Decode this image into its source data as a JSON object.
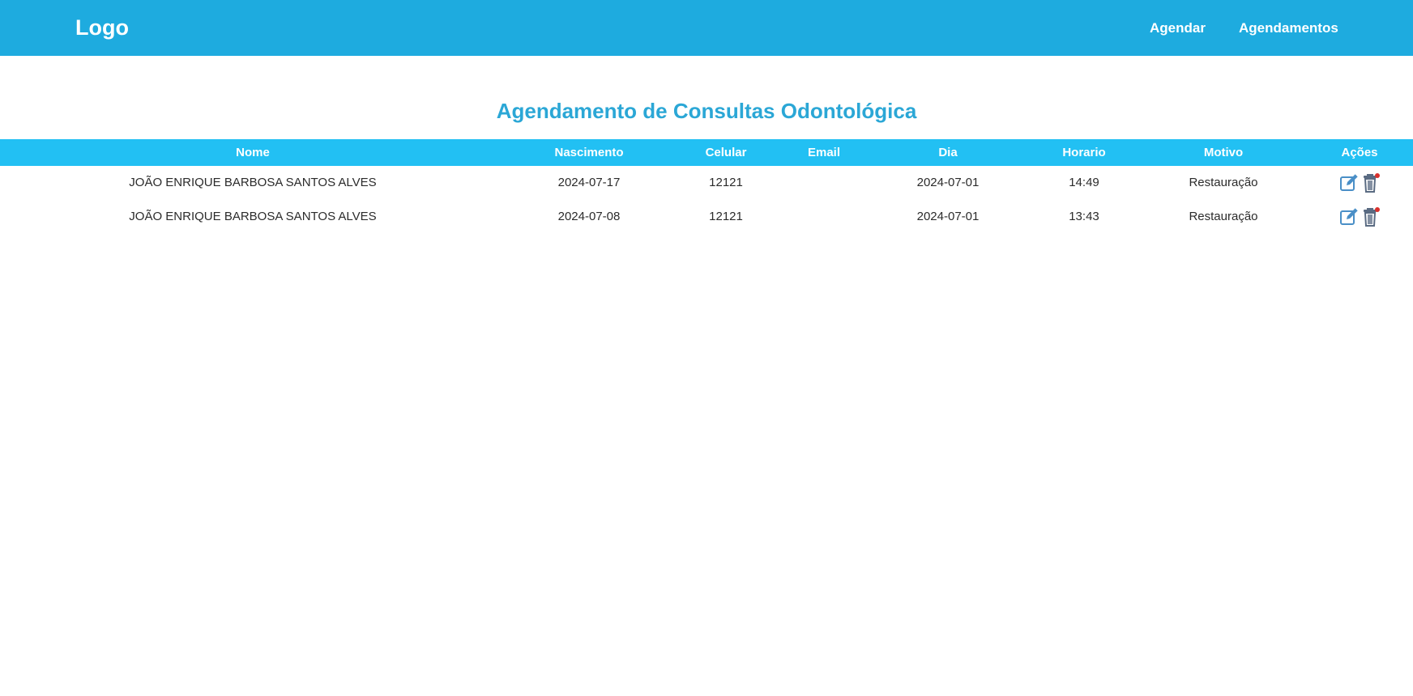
{
  "navbar": {
    "logo": "Logo",
    "links": [
      "Agendar",
      "Agendamentos"
    ],
    "background": "#1eabdf"
  },
  "page": {
    "title": "Agendamento de Consultas Odontológica",
    "title_color": "#2ba7d6"
  },
  "table": {
    "header_background": "#22c0f3",
    "columns": [
      "Nome",
      "Nascimento",
      "Celular",
      "Email",
      "Dia",
      "Horario",
      "Motivo",
      "Ações"
    ],
    "rows": [
      {
        "nome": "JOÃO ENRIQUE BARBOSA SANTOS ALVES",
        "nascimento": "2024-07-17",
        "celular": "12121",
        "email": "",
        "dia": "2024-07-01",
        "horario": "14:49",
        "motivo": "Restauração",
        "actions": [
          "edit-icon",
          "trash-icon"
        ]
      },
      {
        "nome": "JOÃO ENRIQUE BARBOSA SANTOS ALVES",
        "nascimento": "2024-07-08",
        "celular": "12121",
        "email": "",
        "dia": "2024-07-01",
        "horario": "13:43",
        "motivo": "Restauração",
        "actions": [
          "edit-icon",
          "trash-icon"
        ]
      }
    ]
  }
}
